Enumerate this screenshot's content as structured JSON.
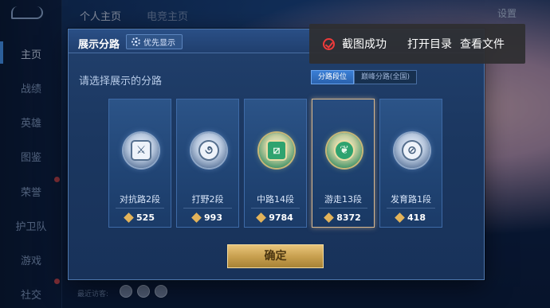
{
  "nav": {
    "top_tabs": [
      "个人主页",
      "电竞主页"
    ],
    "settings": "设置",
    "sidebar": [
      {
        "label": "主页"
      },
      {
        "label": "战绩"
      },
      {
        "label": "英雄"
      },
      {
        "label": "图鉴"
      },
      {
        "label": "荣誉"
      },
      {
        "label": "护卫队"
      },
      {
        "label": "游戏"
      },
      {
        "label": "社交"
      }
    ],
    "recent_visitors": "最近访客:"
  },
  "dialog": {
    "title": "展示分路",
    "priority_button": "优先显示",
    "subtitle": "请选择展示的分路",
    "tabs": [
      {
        "label": "分路段位",
        "active": true
      },
      {
        "label": "巅峰分路(全国)",
        "active": false
      }
    ],
    "cards": [
      {
        "label": "对抗路2段",
        "score": "525",
        "icon": "sword-shield-icon",
        "selected": false
      },
      {
        "label": "打野2段",
        "score": "993",
        "icon": "wind-swirl-icon",
        "selected": false
      },
      {
        "label": "中路14段",
        "score": "9784",
        "icon": "mid-lane-icon",
        "selected": false
      },
      {
        "label": "游走13段",
        "score": "8372",
        "icon": "leaf-wings-icon",
        "selected": true
      },
      {
        "label": "发育路1段",
        "score": "418",
        "icon": "target-icon",
        "selected": false
      }
    ],
    "confirm": "确定"
  },
  "toast": {
    "message": "截图成功",
    "open_dir": "打开目录",
    "view_file": "查看文件"
  }
}
